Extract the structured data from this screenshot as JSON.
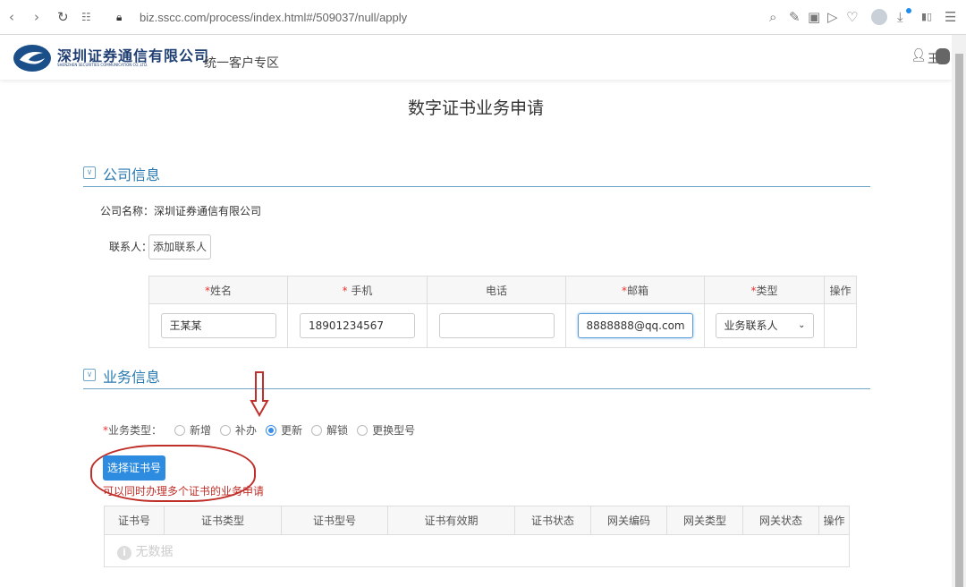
{
  "browser": {
    "url": "biz.sscc.com/process/index.html#/509037/null/apply"
  },
  "header": {
    "company_cn": "深圳证券通信有限公司",
    "company_en": "SHENZHEN SECURITIES COMMUNICATION CO.,LTD.",
    "portal": "统一客户专区",
    "user": "王"
  },
  "page_title": "数字证书业务申请",
  "company_section": {
    "title": "公司信息",
    "name_label": "公司名称：",
    "name_value": "深圳证券通信有限公司",
    "contact_label": "联系人：",
    "add_contact": "添加联系人",
    "columns": [
      {
        "req": "*",
        "label": "姓名"
      },
      {
        "req": "* ",
        "label": "手机"
      },
      {
        "req": "",
        "label": "电话"
      },
      {
        "req": "*",
        "label": "邮箱"
      },
      {
        "req": "*",
        "label": "类型"
      },
      {
        "req": "",
        "label": "操作"
      }
    ],
    "row": {
      "name": "王某某",
      "mobile": "18901234567",
      "phone": "",
      "email": "8888888@qq.com",
      "type": "业务联系人"
    }
  },
  "business_section": {
    "title": "业务信息",
    "type_label": "业务类型：",
    "type_req": "*",
    "types": [
      {
        "label": "新增",
        "selected": false
      },
      {
        "label": "补办",
        "selected": false
      },
      {
        "label": "更新",
        "selected": true
      },
      {
        "label": "解锁",
        "selected": false
      },
      {
        "label": "更换型号",
        "selected": false
      }
    ],
    "select_button": "选择证书号",
    "hint": "可以同时办理多个证书的业务申请",
    "columns": [
      "证书号",
      "证书类型",
      "证书型号",
      "证书有效期",
      "证书状态",
      "网关编码",
      "网关类型",
      "网关状态",
      "操作"
    ],
    "empty": "无数据"
  },
  "colors": {
    "accent": "#2d8ce0",
    "annotation": "#c0302a"
  }
}
